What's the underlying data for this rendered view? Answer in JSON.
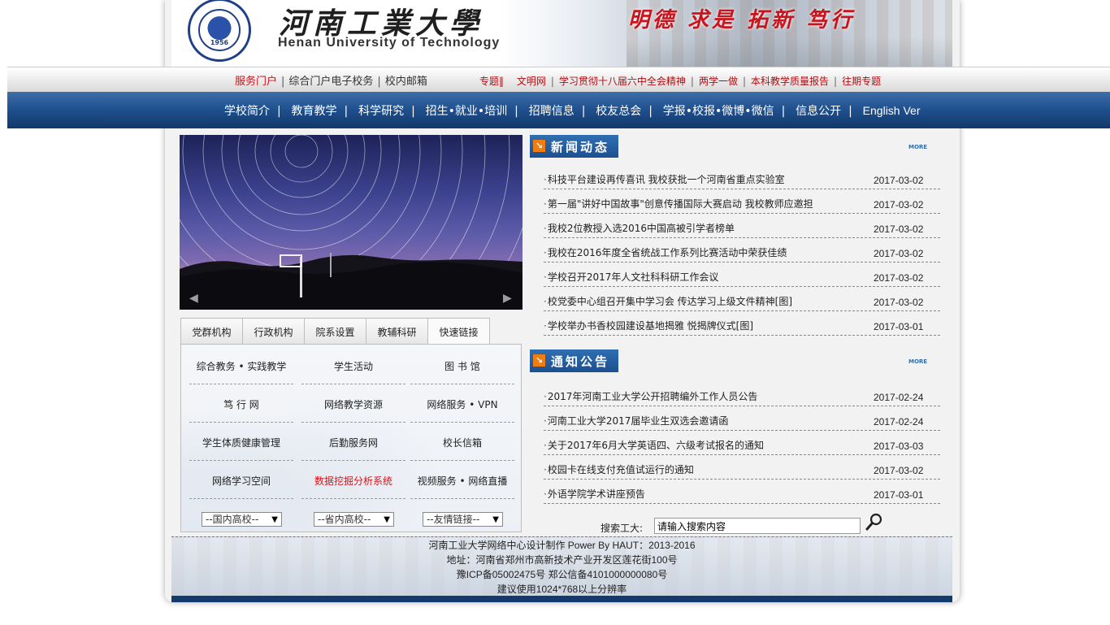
{
  "colors": {
    "nav_blue": "#1f4f8c",
    "accent_red": "#c9141d",
    "section_orange": "#f07d12"
  },
  "banner": {
    "school_name_cn": "河南工業大學",
    "school_name_en": "Henan University of Technology",
    "seal_year": "1956",
    "motto": "明德 求是 拓新 笃行"
  },
  "service_bar": {
    "left_links": [
      "服务门户",
      "综合门户电子校务",
      "校内邮箱"
    ],
    "right_links": [
      "专题‖",
      "文明网",
      "学习贯彻十八届六中全会精神",
      "两学一做",
      "本科教学质量报告",
      "往期专题"
    ]
  },
  "main_nav": {
    "items": [
      "学校简介",
      "教育教学",
      "科学研究",
      "招生•就业•培训",
      "招聘信息",
      "校友总会",
      "学报•校报•微博•微信",
      "信息公开",
      "English Ver"
    ]
  },
  "tabs": {
    "items": [
      "党群机构",
      "行政机构",
      "院系设置",
      "教辅科研",
      "快速链接"
    ],
    "active": "快速链接"
  },
  "quick_links": {
    "rows": [
      [
        "综合教务 • 实践教学",
        "学生活动",
        "图 书 馆"
      ],
      [
        "笃 行 网",
        "网络教学资源",
        "网络服务 • VPN"
      ],
      [
        "学生体质健康管理",
        "后勤服务网",
        "校长信箱"
      ],
      [
        "网络学习空间",
        "数据挖掘分析系统",
        "视频服务 • 网络直播"
      ]
    ],
    "highlight": "数据挖掘分析系统",
    "selects": [
      "--国内高校--",
      "--省内高校--",
      "--友情链接--"
    ]
  },
  "news": {
    "title": "新闻动态",
    "more_label": "MORE",
    "items": [
      {
        "title": "科技平台建设再传喜讯 我校获批一个河南省重点实验室",
        "date": "2017-03-02"
      },
      {
        "title": "第一届\"讲好中国故事\"创意传播国际大赛启动 我校教师应邀担",
        "date": "2017-03-02"
      },
      {
        "title": "我校2位教授入选2016中国高被引学者榜单",
        "date": "2017-03-02"
      },
      {
        "title": "我校在2016年度全省统战工作系列比赛活动中荣获佳绩",
        "date": "2017-03-02"
      },
      {
        "title": "学校召开2017年人文社科科研工作会议",
        "date": "2017-03-02"
      },
      {
        "title": "校党委中心组召开集中学习会 传达学习上级文件精神[图]",
        "date": "2017-03-02"
      },
      {
        "title": "学校举办书香校园建设基地揭雅 悦揭牌仪式[图]",
        "date": "2017-03-01"
      }
    ]
  },
  "notices": {
    "title": "通知公告",
    "more_label": "MORE",
    "items": [
      {
        "title": "2017年河南工业大学公开招聘编外工作人员公告",
        "date": "2017-02-24"
      },
      {
        "title": "河南工业大学2017届毕业生双选会邀请函",
        "date": "2017-02-24"
      },
      {
        "title": "关于2017年6月大学英语四、六级考试报名的通知",
        "date": "2017-03-03"
      },
      {
        "title": "校园卡在线支付充值试运行的通知",
        "date": "2017-03-02"
      },
      {
        "title": "外语学院学术讲座预告",
        "date": "2017-03-01"
      }
    ]
  },
  "search": {
    "label": "搜索工大:",
    "value": "请输入搜索内容",
    "button_icon": "magnifier-icon"
  },
  "footer": {
    "line1": "河南工业大学网络中心设计制作 Power By HAUT：2013-2016",
    "line2": "地址：河南省郑州市高新技术产业开发区莲花街100号",
    "line3": "豫ICP备05002475号 郑公信备4101000000080号",
    "line4": "建议使用1024*768以上分辨率"
  }
}
